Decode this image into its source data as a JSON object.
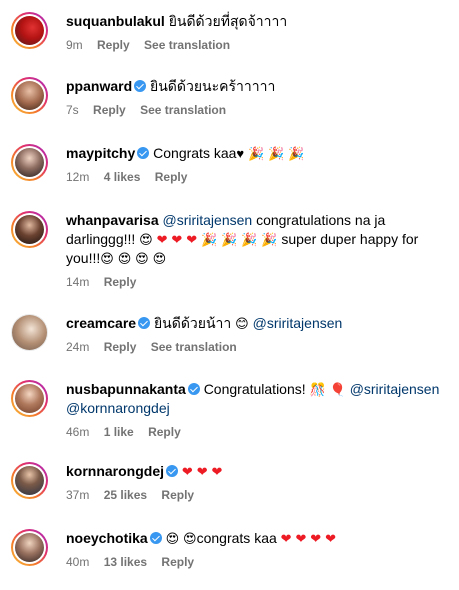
{
  "comments": [
    {
      "username": "suquanbulakul",
      "verified": false,
      "text": "ยินดีด้วยที่สุดจ้าาาา",
      "time": "9m",
      "likes": "",
      "reply": "Reply",
      "translate": "See translation"
    },
    {
      "username": "ppanward",
      "verified": true,
      "text": "ยินดีด้วยนะคร้าาาาา",
      "time": "7s",
      "likes": "",
      "reply": "Reply",
      "translate": "See translation"
    },
    {
      "username": "maypitchy",
      "verified": true,
      "text": "Congrats kaa",
      "time": "12m",
      "likes": "4 likes",
      "reply": "Reply",
      "translate": ""
    },
    {
      "username": "whanpavarisa",
      "verified": false,
      "mention": "@sriritajensen",
      "text": "congratulations na ja darlinggg!!!",
      "text2": "super duper happy for you!!!",
      "time": "14m",
      "likes": "",
      "reply": "Reply",
      "translate": ""
    },
    {
      "username": "creamcare",
      "verified": true,
      "text": "ยินดีด้วยน้าา",
      "mention": "@sriritajensen",
      "time": "24m",
      "likes": "",
      "reply": "Reply",
      "translate": "See translation"
    },
    {
      "username": "nusbapunnakanta",
      "verified": true,
      "text": "Congratulations!",
      "mention": "@sriritajensen",
      "mention2": "@kornnarongdej",
      "time": "46m",
      "likes": "1 like",
      "reply": "Reply",
      "translate": ""
    },
    {
      "username": "kornnarongdej",
      "verified": true,
      "text": "",
      "time": "37m",
      "likes": "25 likes",
      "reply": "Reply",
      "translate": ""
    },
    {
      "username": "noeychotika",
      "verified": true,
      "text": "congrats kaa",
      "time": "40m",
      "likes": "13 likes",
      "reply": "Reply",
      "translate": ""
    }
  ]
}
